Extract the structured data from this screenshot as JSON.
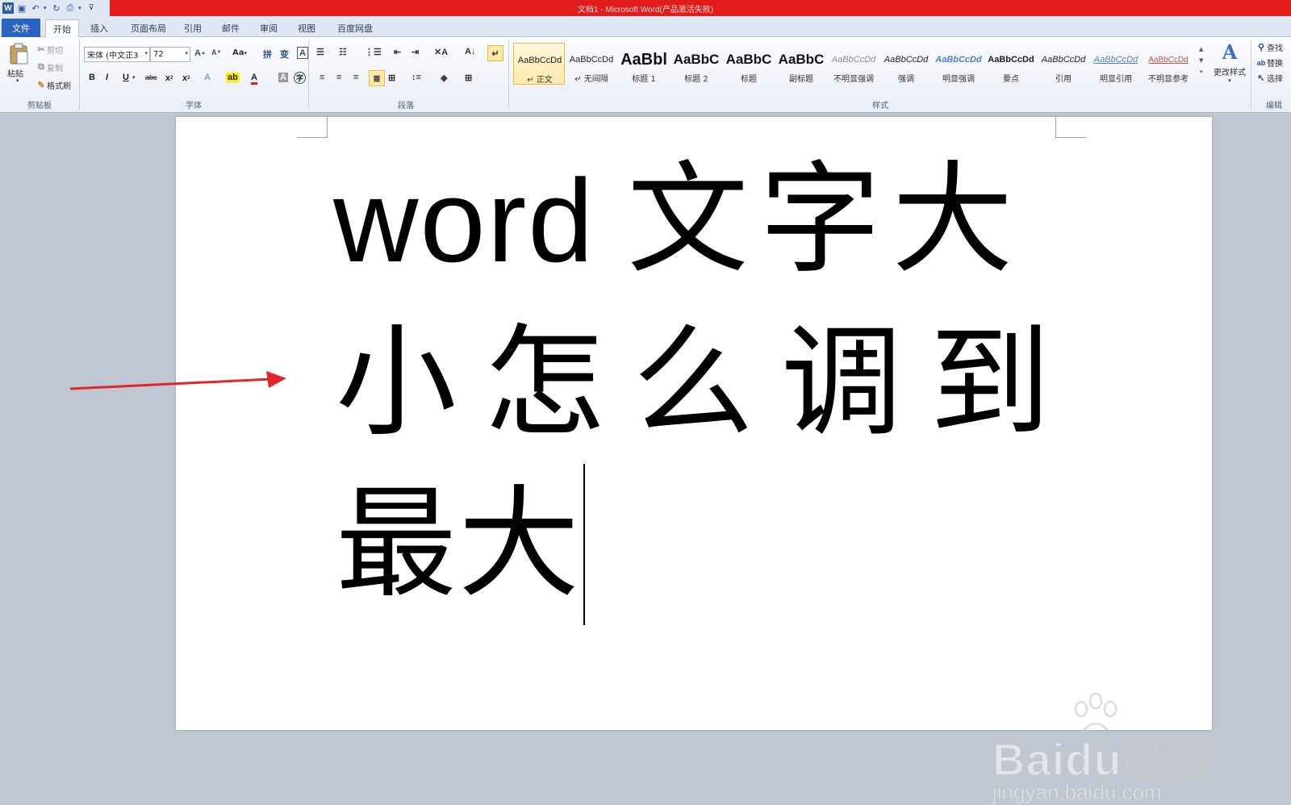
{
  "window": {
    "title": "文档1 - Microsoft Word(产品激活失败)"
  },
  "tabs": [
    "文件",
    "开始",
    "插入",
    "页面布局",
    "引用",
    "邮件",
    "审阅",
    "视图",
    "百度网盘"
  ],
  "clipboard": {
    "paste": "粘贴",
    "cut": "剪切",
    "copy": "复制",
    "format_painter": "格式刷",
    "label": "剪贴板"
  },
  "font": {
    "name": "宋体 (中文正3",
    "size": "72",
    "label": "字体",
    "case": "Aa"
  },
  "paragraph": {
    "label": "段落"
  },
  "styles": {
    "label": "样式",
    "items": [
      {
        "preview": "AaBbCcDd",
        "name": "↵ 正文",
        "selected": true
      },
      {
        "preview": "AaBbCcDd",
        "name": "↵ 无间隔"
      },
      {
        "preview": "AaBbl",
        "name": "标题 1"
      },
      {
        "preview": "AaBbC",
        "name": "标题 2"
      },
      {
        "preview": "AaBbC",
        "name": "标题"
      },
      {
        "preview": "AaBbC",
        "name": "副标题"
      },
      {
        "preview": "AaBbCcDd",
        "name": "不明显强调"
      },
      {
        "preview": "AaBbCcDd",
        "name": "强调"
      },
      {
        "preview": "AaBbCcDd",
        "name": "明显强调"
      },
      {
        "preview": "AaBbCcDd",
        "name": "要点"
      },
      {
        "preview": "AaBbCcDd",
        "name": "引用"
      },
      {
        "preview": "AaBbCcDd",
        "name": "明显引用"
      },
      {
        "preview": "AaBbCcDd",
        "name": "不明显参考"
      }
    ],
    "change_styles": "更改样式"
  },
  "editing": {
    "find": "查找",
    "replace": "替换",
    "select": "选择",
    "label": "编辑"
  },
  "document": {
    "line1_latin": "word",
    "line1_cjk": "文字大",
    "line2": "小怎么调到",
    "line3": "最大"
  },
  "watermark": {
    "brand": "Baidu经验",
    "url": "jingyan.baidu.com"
  },
  "colors": {
    "title_bar": "#e21b1b",
    "file_tab": "#2b63c0",
    "annotation_arrow": "#e0262a"
  }
}
